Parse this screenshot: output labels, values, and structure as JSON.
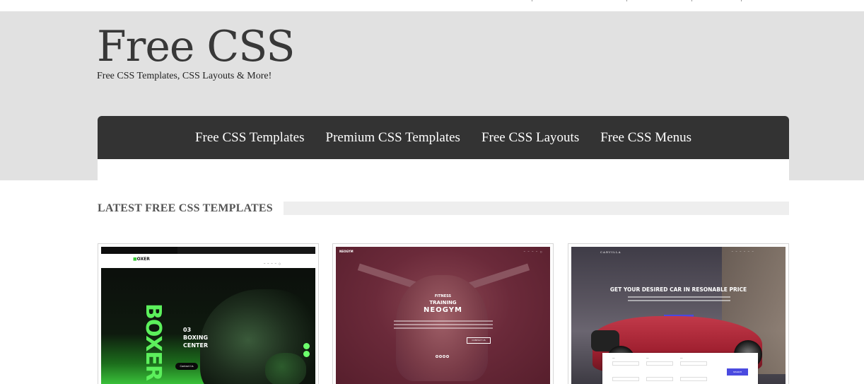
{
  "site": {
    "title": "Free CSS",
    "tagline": "Free CSS Templates, CSS Layouts & More!"
  },
  "nav": {
    "items": [
      {
        "label": "Free CSS Templates"
      },
      {
        "label": "Premium CSS Templates"
      },
      {
        "label": "Free CSS Layouts"
      },
      {
        "label": "Free CSS Menus"
      }
    ]
  },
  "section": {
    "title": "LATEST FREE CSS TEMPLATES"
  },
  "templates": [
    {
      "logo": "OXER",
      "vertical_text": "BOXER",
      "caption_number": "03",
      "caption_line1": "BOXING",
      "caption_line2": "CENTER",
      "button": "Contact Us"
    },
    {
      "logo": "NEOGYM",
      "line1": "FITNESS",
      "line2": "TRAINING",
      "line3": "NEOGYM",
      "button": "CONTACT US"
    },
    {
      "logo": "CARVILLA",
      "headline": "GET YOUR DESIRED CAR IN RESONABLE PRICE",
      "button": "CONTACT US",
      "search_button": "SEARCH"
    }
  ],
  "colors": {
    "header_bg": "#e1e1e1",
    "nav_bg": "#333333",
    "section_rule": "#eeeeee",
    "accent_green": "#5cf05c",
    "accent_blue": "#4a4ae0"
  }
}
